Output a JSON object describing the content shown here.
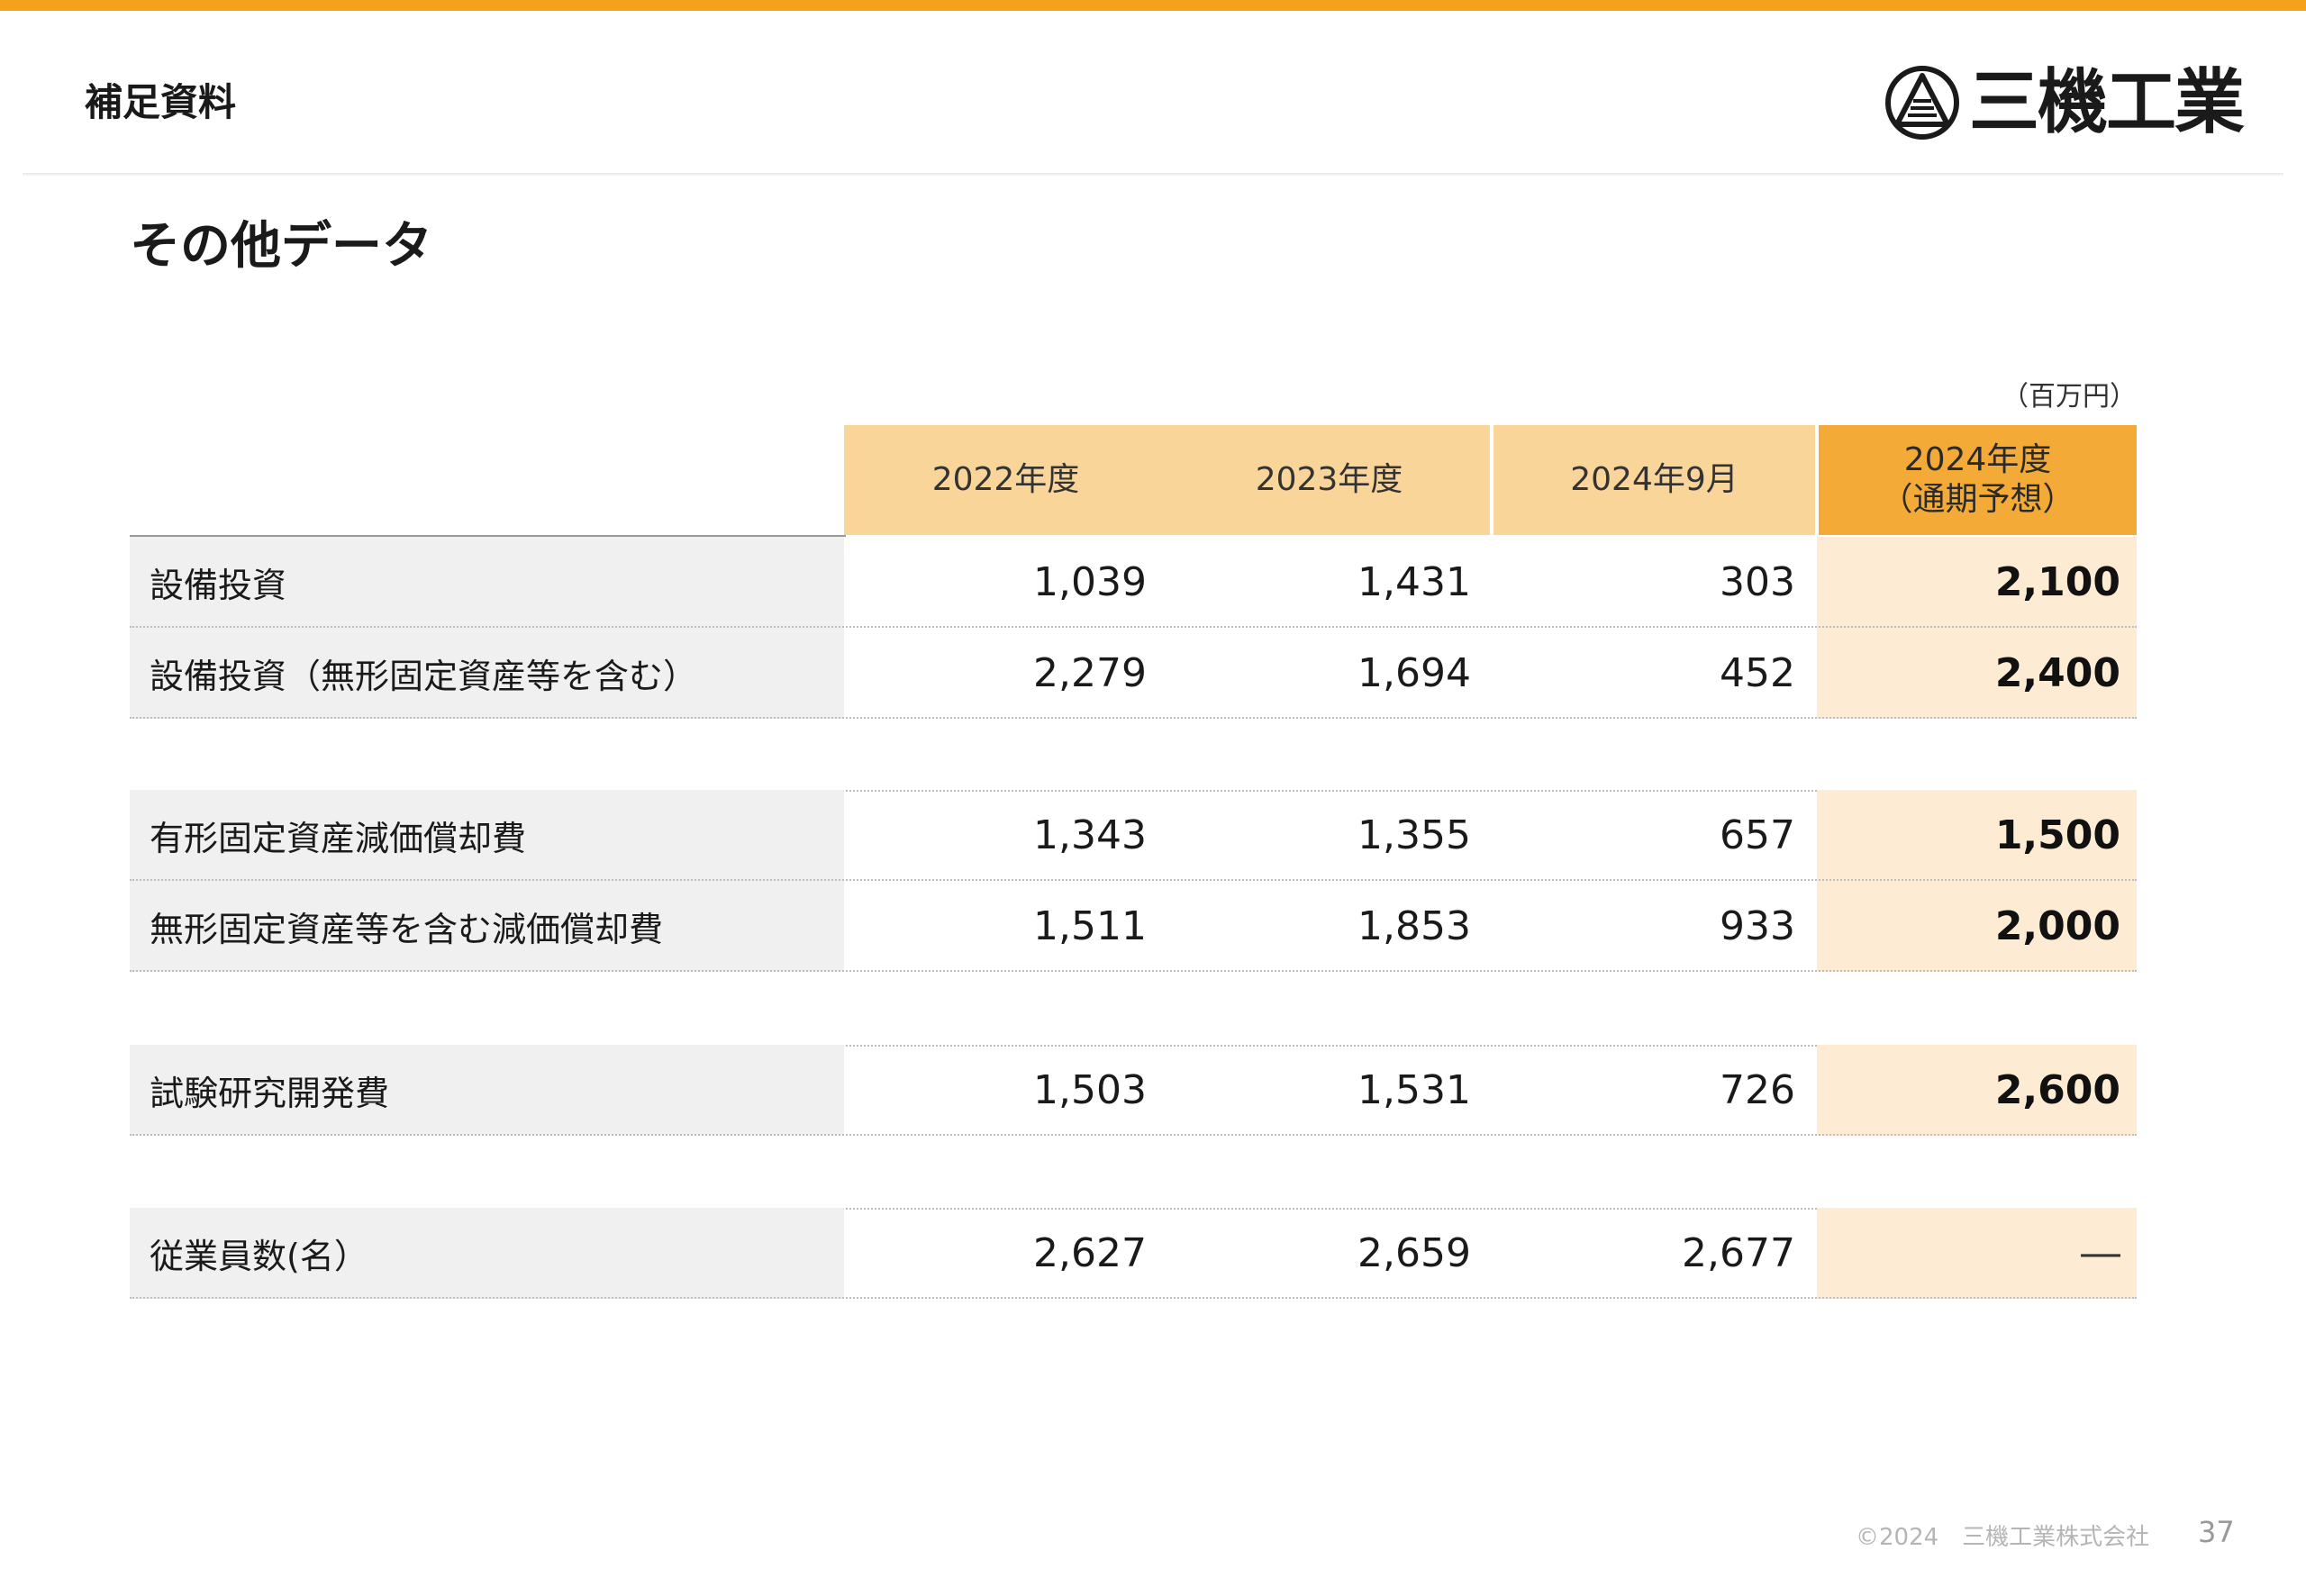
{
  "header": {
    "section_label": "補足資料",
    "logo_text": "三機工業"
  },
  "page": {
    "title": "その他データ",
    "unit_note": "（百万円）"
  },
  "table": {
    "columns": [
      {
        "label": "2022年度"
      },
      {
        "label": "2023年度"
      },
      {
        "label": "2024年9月"
      },
      {
        "label": "2024年度",
        "sub": "（通期予想）"
      }
    ],
    "groups": [
      {
        "rows": [
          {
            "label": "設備投資",
            "values": [
              "1,039",
              "1,431",
              "303"
            ],
            "forecast": "2,100"
          },
          {
            "label": "設備投資（無形固定資産等を含む）",
            "values": [
              "2,279",
              "1,694",
              "452"
            ],
            "forecast": "2,400"
          }
        ]
      },
      {
        "rows": [
          {
            "label": "有形固定資産減価償却費",
            "values": [
              "1,343",
              "1,355",
              "657"
            ],
            "forecast": "1,500"
          },
          {
            "label": "無形固定資産等を含む減価償却費",
            "values": [
              "1,511",
              "1,853",
              "933"
            ],
            "forecast": "2,000"
          }
        ]
      },
      {
        "rows": [
          {
            "label": "試験研究開発費",
            "values": [
              "1,503",
              "1,531",
              "726"
            ],
            "forecast": "2,600"
          }
        ]
      },
      {
        "rows": [
          {
            "label": "従業員数(名）",
            "values": [
              "2,627",
              "2,659",
              "2,677"
            ],
            "forecast": "―"
          }
        ]
      }
    ]
  },
  "footer": {
    "copyright": "©2024　三機工業株式会社",
    "page_number": "37"
  },
  "colors": {
    "accent": "#f5a11c",
    "header_light": "#f9d59a",
    "header_strong": "#f4aa36",
    "forecast_bg": "#fdebd3",
    "label_bg": "#f0f0f0"
  }
}
